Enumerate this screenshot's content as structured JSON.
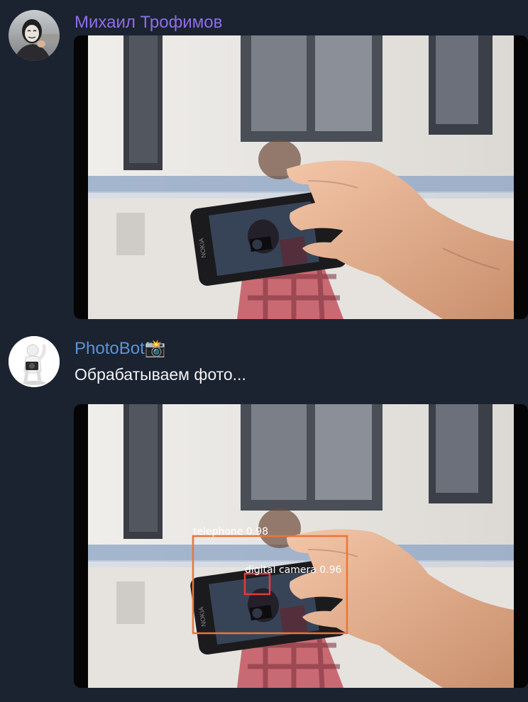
{
  "messages": [
    {
      "sender": "Михаил Трофимов",
      "sender_color": "#8d6ee8",
      "avatar": "masked-person-avatar",
      "attachment": "photo-hand-holding-phone"
    },
    {
      "sender": "PhotoBot📸",
      "sender_color": "#5b94d6",
      "avatar": "white-figure-camera-avatar",
      "text": "Обрабатываем фото...",
      "attachment": "photo-with-detections",
      "detections": [
        {
          "label": "telephone",
          "score": "0.98",
          "color": "#e8763a"
        },
        {
          "label": "digital camera",
          "score": "0.96",
          "color": "#e23b3b"
        }
      ]
    }
  ]
}
